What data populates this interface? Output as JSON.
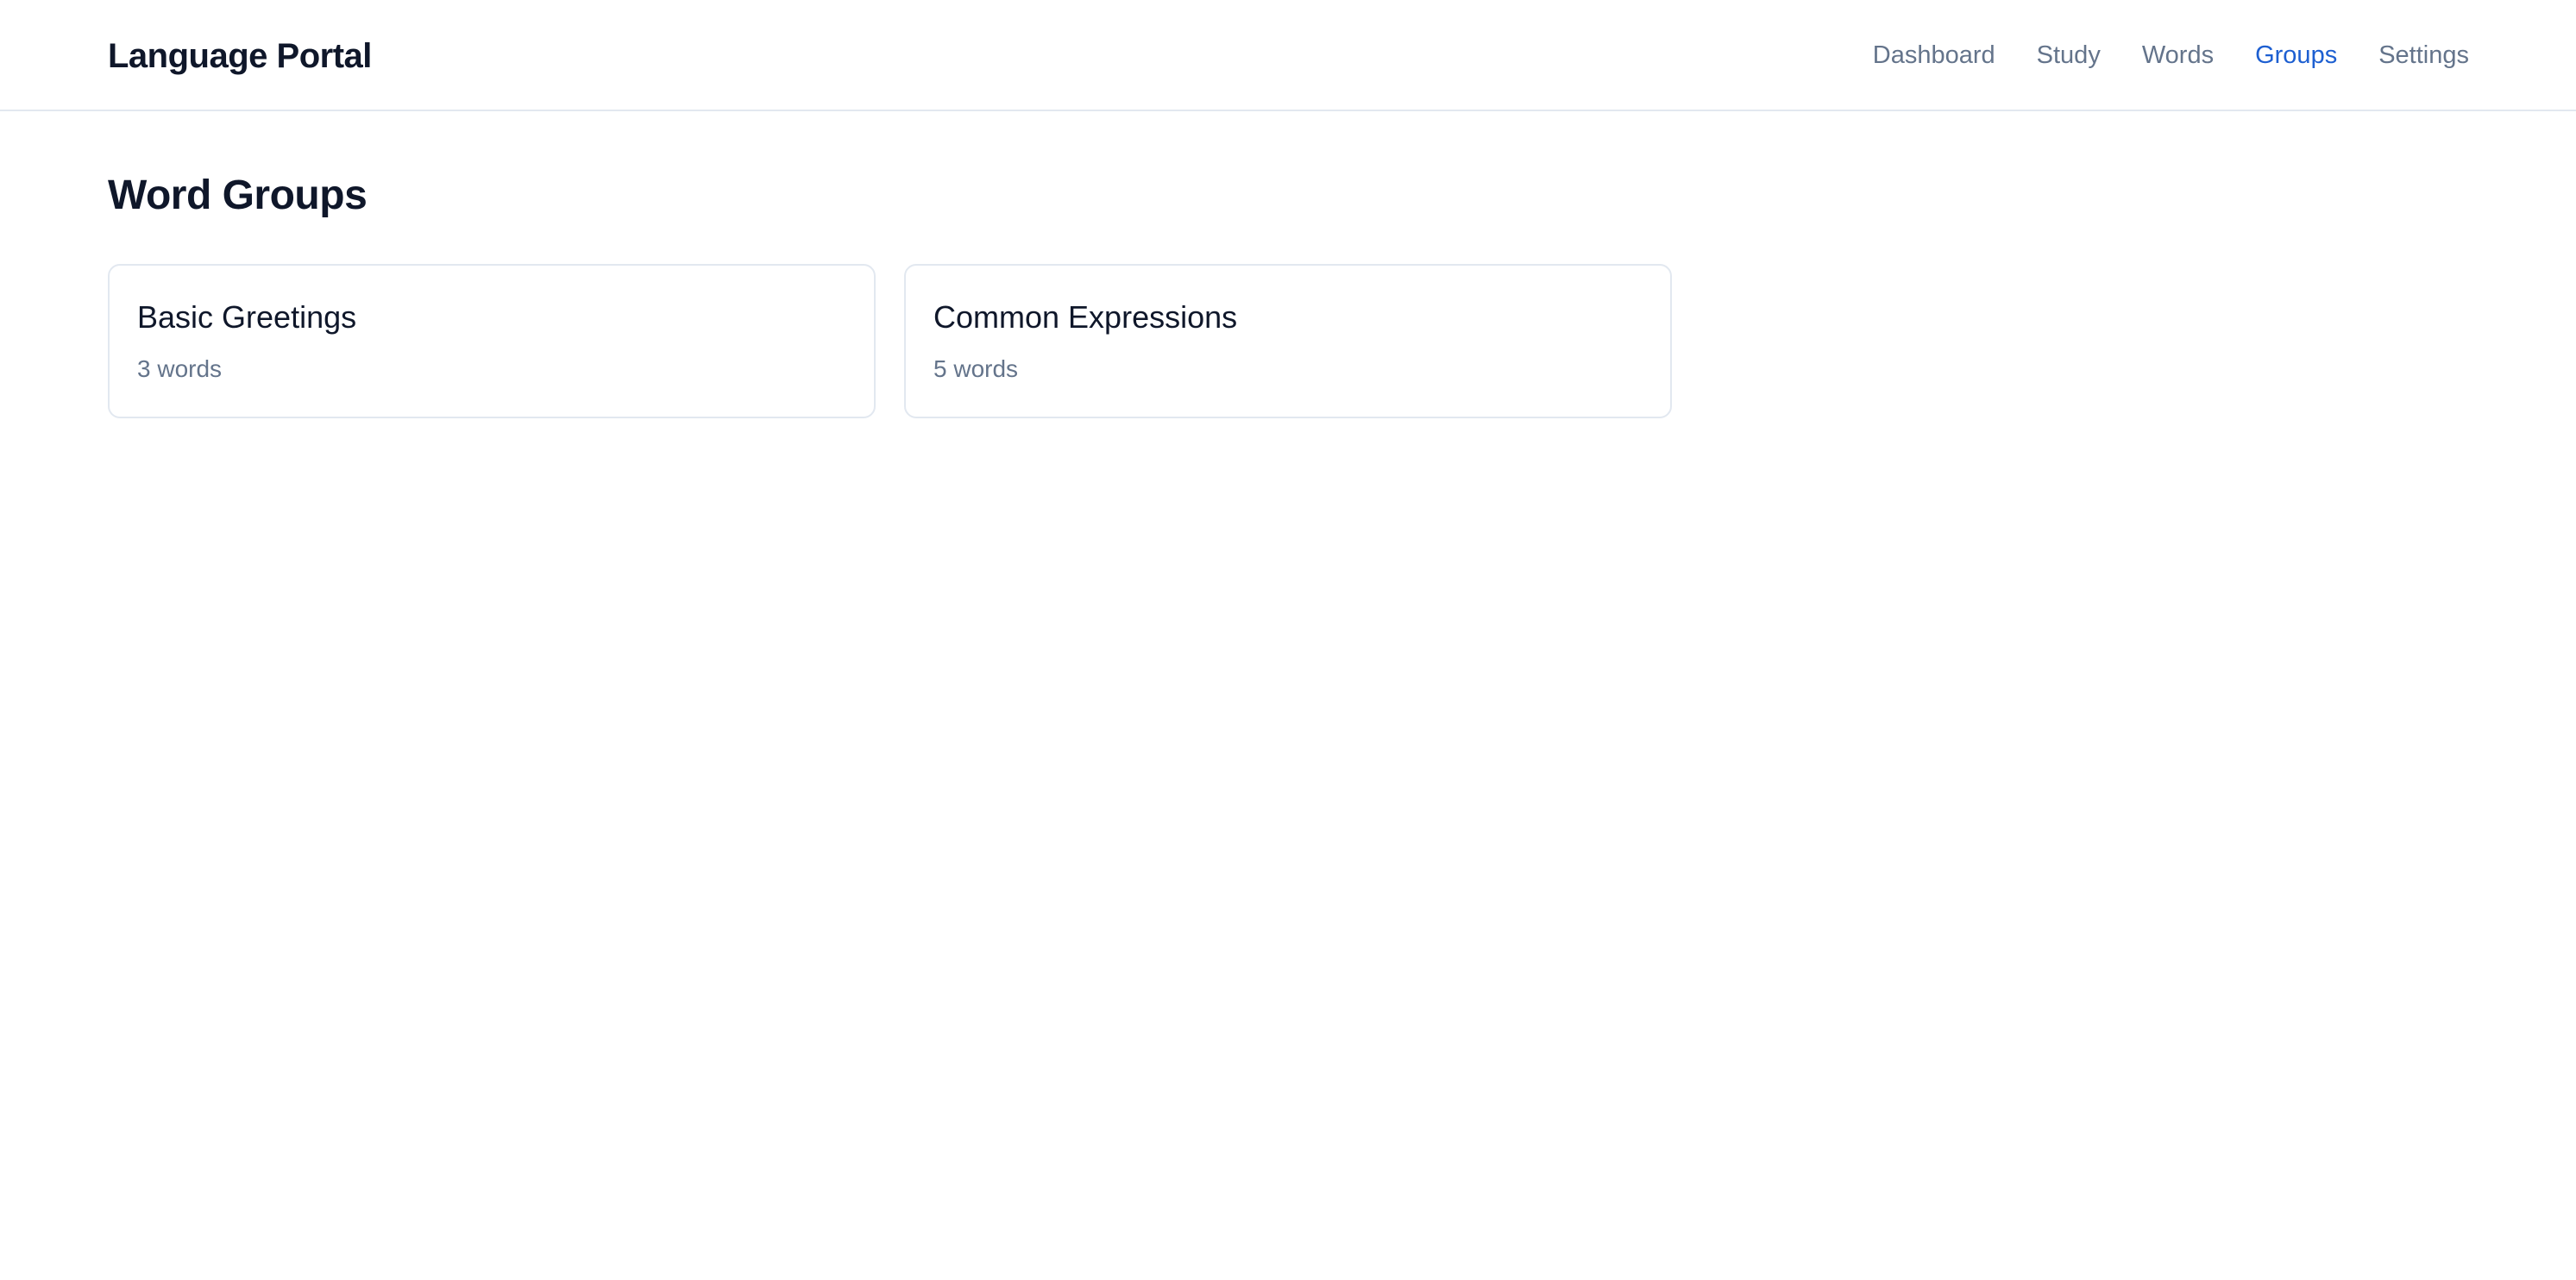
{
  "app": {
    "title": "Language Portal"
  },
  "nav": {
    "items": [
      {
        "label": "Dashboard"
      },
      {
        "label": "Study"
      },
      {
        "label": "Words"
      },
      {
        "label": "Groups"
      },
      {
        "label": "Settings"
      }
    ],
    "active": "Groups",
    "active_color": "#1d5fd1",
    "inactive_color": "#64748b"
  },
  "main": {
    "title": "Word Groups",
    "groups": [
      {
        "name": "Basic Greetings",
        "count": "3 words"
      },
      {
        "name": "Common Expressions",
        "count": "5 words"
      }
    ]
  }
}
